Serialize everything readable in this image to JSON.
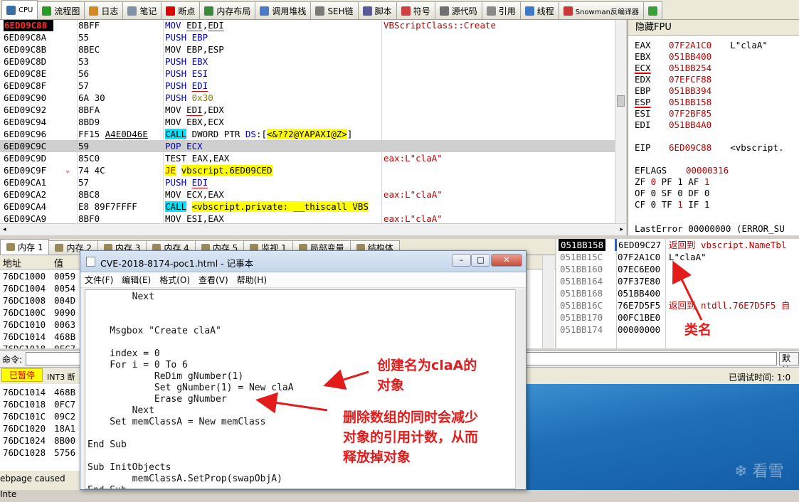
{
  "tabs": [
    {
      "label": "CPU",
      "icon": "cpu-icon",
      "active": true,
      "color": "#3a6ea5"
    },
    {
      "label": "流程图",
      "icon": "graph-icon",
      "color": "#2a9a2a"
    },
    {
      "label": "日志",
      "icon": "log-icon",
      "color": "#d08a20"
    },
    {
      "label": "笔记",
      "icon": "notes-icon",
      "color": "#8090a8"
    },
    {
      "label": "断点",
      "icon": "breakpoint-icon",
      "color": "#e00000"
    },
    {
      "label": "内存布局",
      "icon": "memory-map-icon",
      "color": "#3a8a3a"
    },
    {
      "label": "调用堆栈",
      "icon": "call-stack-icon",
      "color": "#4a7ac8"
    },
    {
      "label": "SEH链",
      "icon": "seh-icon",
      "color": "#7a7a7a"
    },
    {
      "label": "脚本",
      "icon": "script-icon",
      "color": "#5a5a9a"
    },
    {
      "label": "符号",
      "icon": "symbols-icon",
      "color": "#d04040"
    },
    {
      "label": "源代码",
      "icon": "source-icon",
      "color": "#707070"
    },
    {
      "label": "引用",
      "icon": "references-icon",
      "color": "#8a8a8a"
    },
    {
      "label": "线程",
      "icon": "threads-icon",
      "color": "#3a7ac8"
    },
    {
      "label": "Snowman反编译器",
      "icon": "snowman-icon",
      "color": "#c83a3a"
    },
    {
      "label": "",
      "icon": "plugin-icon",
      "color": "#3aa03a"
    }
  ],
  "disasm": [
    {
      "addr": "6ED09C88",
      "hex": "8BFF",
      "asm": "<span class='bl'>MOV</span> <span class='ul'>EDI</span>,<span class='ul'>EDI</span>",
      "comment": "VBScriptClass::Create",
      "hl": true
    },
    {
      "addr": "6ED09C8A",
      "hex": "55",
      "asm": "<span class='bl'>PUSH EBP</span>",
      "comment": ""
    },
    {
      "addr": "6ED09C8B",
      "hex": "8BEC",
      "asm": "MOV EBP,ESP",
      "comment": ""
    },
    {
      "addr": "6ED09C8D",
      "hex": "53",
      "asm": "<span class='bl'>PUSH EBX</span>",
      "comment": ""
    },
    {
      "addr": "6ED09C8E",
      "hex": "56",
      "asm": "<span class='bl'>PUSH ESI</span>",
      "comment": ""
    },
    {
      "addr": "6ED09C8F",
      "hex": "57",
      "asm": "<span class='bl'>PUSH <span class='ul'>EDI</span></span>",
      "comment": ""
    },
    {
      "addr": "6ED09C90",
      "hex": "6A 30",
      "asm": "<span class='bl'>PUSH</span> <span class='num'>0x30</span>",
      "comment": ""
    },
    {
      "addr": "6ED09C92",
      "hex": "8BFA",
      "asm": "MOV <span class='ul'>EDI</span>,EDX",
      "comment": ""
    },
    {
      "addr": "6ED09C94",
      "hex": "8BD9",
      "asm": "MOV EBX,ECX",
      "comment": ""
    },
    {
      "addr": "6ED09C96",
      "hex": "FF15 <span style='text-decoration:underline'>A4E0D46E</span>",
      "asm": "<span class='hc'>CALL</span> DWORD PTR <span class='bl'>DS</span>:[<span class='hy'>&lt;&amp;??2@YAPAXI@Z&gt;</span>]",
      "comment": ""
    },
    {
      "addr": "6ED09C9C",
      "hex": "59",
      "asm": "<span class='bl'>POP ECX</span>",
      "comment": "",
      "cur": true
    },
    {
      "addr": "6ED09C9D",
      "hex": "85C0",
      "asm": "TEST EAX,EAX",
      "comment": "eax:L\"claA\""
    },
    {
      "addr": "6ED09C9F",
      "hex": "74 4C",
      "asm": "<span class='hy' style='color:#e00000'>JE</span> <span class='hy'>vbscript.6ED09CED</span>",
      "comment": "",
      "arrow": "⌄"
    },
    {
      "addr": "6ED09CA1",
      "hex": "57",
      "asm": "<span class='bl'>PUSH <span class='ul'>EDI</span></span>",
      "comment": ""
    },
    {
      "addr": "6ED09CA2",
      "hex": "8BC8",
      "asm": "MOV ECX,EAX",
      "comment": "eax:L\"claA\""
    },
    {
      "addr": "6ED09CA4",
      "hex": "E8 89F7FFFF",
      "asm": "<span class='hc'>CALL</span> <span class='hy'>&lt;vbscript.private: __thiscall VBS</span>",
      "comment": ""
    },
    {
      "addr": "6ED09CA9",
      "hex": "8BF0",
      "asm": "MOV ESI,EAX",
      "comment": "eax:L\"claA\""
    }
  ],
  "regs": {
    "header": "隐藏FPU",
    "rows": [
      {
        "n": "EAX",
        "v": "07F2A1C0",
        "c": "L\"claA\""
      },
      {
        "n": "EBX",
        "v": "051BB400",
        "c": ""
      },
      {
        "n": "ECX",
        "v": "051BB254",
        "c": "",
        "u": true
      },
      {
        "n": "EDX",
        "v": "07EFCF88",
        "c": ""
      },
      {
        "n": "EBP",
        "v": "051BB394",
        "c": ""
      },
      {
        "n": "ESP",
        "v": "051BB158",
        "c": "",
        "u": true
      },
      {
        "n": "ESI",
        "v": "07F2BF85",
        "c": ""
      },
      {
        "n": "EDI",
        "v": "051BB4A0",
        "c": ""
      }
    ],
    "eip": {
      "n": "EIP",
      "v": "6ED09C88",
      "c": "<vbscript."
    },
    "eflags": {
      "n": "EFLAGS",
      "v": "00000316"
    },
    "flags": [
      "ZF <r>0</r>  PF 1  AF <r>1</r>",
      "OF 0  SF 0  DF 0",
      "CF 0  TF <r>1</r>  IF 1"
    ],
    "lasterror": "LastError  00000000 (ERROR_SU"
  },
  "memtabs": [
    {
      "label": "内存 1",
      "active": true
    },
    {
      "label": "内存 2"
    },
    {
      "label": "内存 3"
    },
    {
      "label": "内存 4"
    },
    {
      "label": "内存 5"
    },
    {
      "label": "监视 1"
    },
    {
      "label": "局部变量"
    },
    {
      "label": "结构体"
    }
  ],
  "dump": {
    "col_addr": "地址",
    "col_val": "值",
    "rows": [
      [
        "76DC1000",
        "0059"
      ],
      [
        "76DC1004",
        "0054"
      ],
      [
        "76DC1008",
        "004D"
      ],
      [
        "76DC100C",
        "9090"
      ],
      [
        "76DC1010",
        "0063"
      ],
      [
        "76DC1014",
        "468B"
      ],
      [
        "76DC1018",
        "0FC7"
      ]
    ]
  },
  "stack": {
    "rows": [
      {
        "a": "051BB158",
        "v": "6ED09C27",
        "c": "返回到 vbscript.NameTbl",
        "top": true
      },
      {
        "a": "051BB15C",
        "v": "07F2A1C0",
        "c": "L\"claA\"",
        "black": true
      },
      {
        "a": "051BB160",
        "v": "07EC6E00",
        "c": ""
      },
      {
        "a": "051BB164",
        "v": "07F37E80",
        "c": ""
      },
      {
        "a": "051BB168",
        "v": "051BB400",
        "c": ""
      },
      {
        "a": "051BB16C",
        "v": "76E7D5F5",
        "c": "返回到 ntdll.76E7D5F5 自"
      },
      {
        "a": "051BB170",
        "v": "00FC1BE0",
        "c": ""
      },
      {
        "a": "051BB174",
        "v": "00000000",
        "c": ""
      }
    ]
  },
  "cmd": {
    "label": "命令:",
    "default_btn": "默认"
  },
  "status": {
    "paused": "已暂停",
    "int3": "INT3 断",
    "debug_time": "已调试时间:  1:0"
  },
  "dump2": [
    [
      "76DC1014",
      "468B"
    ],
    [
      "76DC1018",
      "0FC7"
    ],
    [
      "76DC101C",
      "09C2"
    ],
    [
      "76DC1020",
      "18A1"
    ],
    [
      "76DC1024",
      "8B00"
    ],
    [
      "76DC1028",
      "5756"
    ]
  ],
  "taskstrip": "ebpage caused Inte",
  "notepad": {
    "title": "CVE-2018-8174-poc1.html - 记事本",
    "menu": [
      "文件(F)",
      "编辑(E)",
      "格式(O)",
      "查看(V)",
      "帮助(H)"
    ],
    "lines": [
      "        Next",
      "",
      "",
      "    Msgbox \"Create claA\"",
      "",
      "    index = 0",
      "    For i = 0 To 6",
      "            ReDim gNumber(1)",
      "            Set gNumber(1) = New claA",
      "            Erase gNumber",
      "        Next",
      "    Set memClassA = New memClass",
      "",
      "End Sub",
      "",
      "Sub InitObjects",
      "        memClassA.SetProp(swapObjA)",
      "End Sub"
    ]
  },
  "annotations": {
    "a1": "创建名为claA的\n对象",
    "a2": "删除数组的同时会减少\n对象的引用计数，从而\n释放掉对象",
    "a3": "类名"
  },
  "watermark": "看雪",
  "colors": {
    "accent_red": "#e31b1b",
    "highlight_yellow": "#ffff00",
    "highlight_cyan": "#00e5ff"
  }
}
